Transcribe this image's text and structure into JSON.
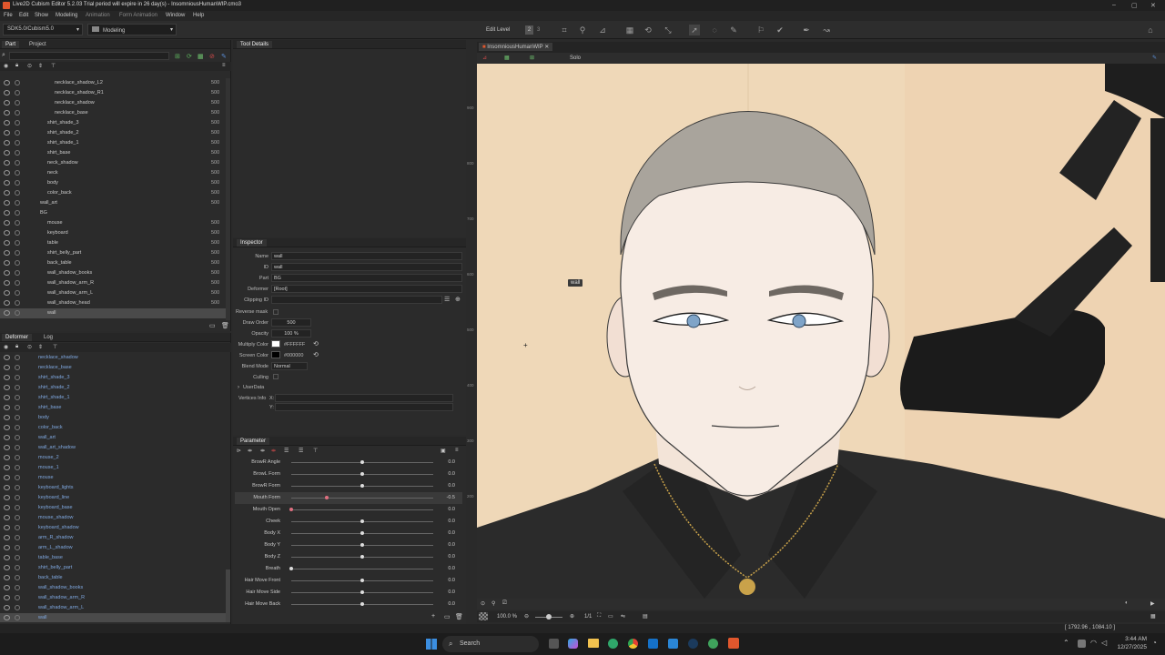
{
  "window": {
    "title": "Live2D Cubism Editor 5.2.03   Trial period will expire in 26 day(s)   -  InsomniousHumanWIP.cmo3"
  },
  "menu": [
    "File",
    "Edit",
    "Show",
    "Modeling",
    "Animation",
    "Form Animation",
    "Window",
    "Help"
  ],
  "toolbar": {
    "sdk": "SDK5.0/Cubism5.0",
    "mode": "Modeling",
    "edit_level_label": "Edit Level",
    "levels": [
      "1",
      "2",
      "3"
    ]
  },
  "part_panel": {
    "tabs": [
      "Part",
      "Project"
    ],
    "rows": [
      {
        "name": "necklace_shadow_L2",
        "num": "500",
        "indent": 60
      },
      {
        "name": "necklace_shadow_R1",
        "num": "500",
        "indent": 60
      },
      {
        "name": "necklace_shadow",
        "num": "500",
        "indent": 60
      },
      {
        "name": "necklace_base",
        "num": "500",
        "indent": 60
      },
      {
        "name": "shirt_shade_3",
        "num": "500",
        "indent": 52
      },
      {
        "name": "shirt_shade_2",
        "num": "500",
        "indent": 52
      },
      {
        "name": "shirt_shade_1",
        "num": "500",
        "indent": 52
      },
      {
        "name": "shirt_base",
        "num": "500",
        "indent": 52
      },
      {
        "name": "neck_shadow",
        "num": "500",
        "indent": 52
      },
      {
        "name": "neck",
        "num": "500",
        "indent": 52
      },
      {
        "name": "body",
        "num": "500",
        "indent": 52
      },
      {
        "name": "color_back",
        "num": "500",
        "indent": 52
      },
      {
        "name": "wall_art",
        "num": "500",
        "indent": 44
      },
      {
        "name": "BG",
        "num": "",
        "indent": 44
      },
      {
        "name": "mouse",
        "num": "500",
        "indent": 52
      },
      {
        "name": "keyboard",
        "num": "500",
        "indent": 52
      },
      {
        "name": "table",
        "num": "500",
        "indent": 52
      },
      {
        "name": "shirt_belly_part",
        "num": "500",
        "indent": 52
      },
      {
        "name": "back_table",
        "num": "500",
        "indent": 52
      },
      {
        "name": "wall_shadow_books",
        "num": "500",
        "indent": 52
      },
      {
        "name": "wall_shadow_arm_R",
        "num": "500",
        "indent": 52
      },
      {
        "name": "wall_shadow_arm_L",
        "num": "500",
        "indent": 52
      },
      {
        "name": "wall_shadow_head",
        "num": "500",
        "indent": 52
      },
      {
        "name": "wall",
        "num": "",
        "indent": 52
      }
    ]
  },
  "deformer_panel": {
    "tabs": [
      "Deformer",
      "Log"
    ],
    "rows": [
      "necklace_shadow",
      "necklace_base",
      "shirt_shade_3",
      "shirt_shade_2",
      "shirt_shade_1",
      "shirt_base",
      "body",
      "color_back",
      "wall_art",
      "wall_art_shadow",
      "mouse_2",
      "mouse_1",
      "mouse",
      "keyboard_lights",
      "keyboard_line",
      "keyboard_base",
      "mouse_shadow",
      "keyboard_shadow",
      "arm_R_shadow",
      "arm_L_shadow",
      "table_base",
      "shirt_belly_part",
      "back_table",
      "wall_shadow_books",
      "wall_shadow_arm_R",
      "wall_shadow_arm_L",
      "wall"
    ]
  },
  "tool_details": {
    "title": "Tool Details"
  },
  "inspector": {
    "title": "Inspector",
    "fields": [
      {
        "label": "Name",
        "value": "wall"
      },
      {
        "label": "ID",
        "value": "wall"
      },
      {
        "label": "Part",
        "value": "BG"
      },
      {
        "label": "Deformer",
        "value": "[Root]"
      },
      {
        "label": "Clipping ID",
        "value": ""
      }
    ],
    "reverse_mask": "Reverse mask",
    "draw_order_label": "Draw Order",
    "draw_order": "500",
    "opacity_label": "Opacity",
    "opacity": "100 %",
    "multiply_label": "Multiply Color",
    "multiply": "#FFFFFF",
    "screen_label": "Screen Color",
    "screen": "#000000",
    "blend_label": "Blend Mode",
    "blend": "Normal",
    "culling": "Culling",
    "userdata": "UserData",
    "vertices_label": "Vertices Info",
    "vx": "X:",
    "vy": "Y:"
  },
  "parameters": {
    "title": "Parameter",
    "items": [
      {
        "name": "BrowR Angle",
        "value": "0.0",
        "knob": 0.5
      },
      {
        "name": "BrowL Form",
        "value": "0.0",
        "knob": 0.5
      },
      {
        "name": "BrowR Form",
        "value": "0.0",
        "knob": 0.5
      },
      {
        "name": "Mouth Form",
        "value": "-0.5",
        "knob": 0.25
      },
      {
        "name": "Mouth Open",
        "value": "0.0",
        "knob": 0.0
      },
      {
        "name": "Cheek",
        "value": "0.0",
        "knob": 0.5
      },
      {
        "name": "Body X",
        "value": "0.0",
        "knob": 0.5
      },
      {
        "name": "Body Y",
        "value": "0.0",
        "knob": 0.5
      },
      {
        "name": "Body Z",
        "value": "0.0",
        "knob": 0.5
      },
      {
        "name": "Breath",
        "value": "0.0",
        "knob": 0.0
      },
      {
        "name": "Hair Move Front",
        "value": "0.0",
        "knob": 0.5
      },
      {
        "name": "Hair Move Side",
        "value": "0.0",
        "knob": 0.5
      },
      {
        "name": "Hair Move Back",
        "value": "0.0",
        "knob": 0.5
      }
    ]
  },
  "viewport": {
    "tab": "InsomniousHumanWIP",
    "solo": "Solo",
    "tooltip": "wall",
    "ruler": [
      "900",
      "800",
      "700",
      "600",
      "500",
      "400",
      "300",
      "200"
    ],
    "zoom": "100.0 %",
    "ratio": "1/1",
    "coords": "[ 1792.96 , 1084.10 ]"
  },
  "taskbar": {
    "search": "Search",
    "time": "3:44 AM",
    "date": "12/27/2025"
  }
}
